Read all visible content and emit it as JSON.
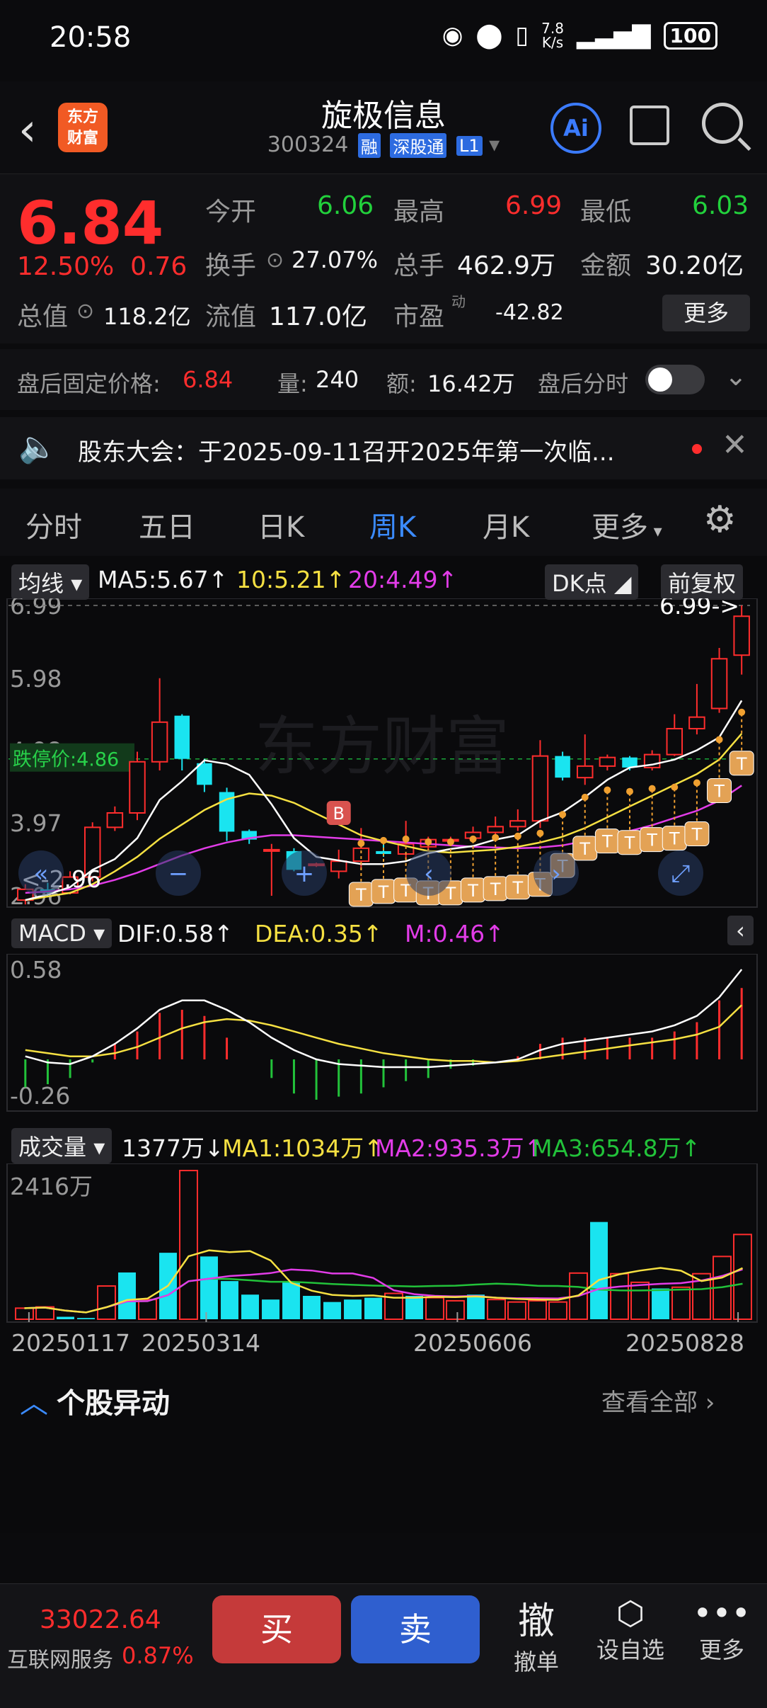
{
  "status": {
    "time": "20:58",
    "net_speed_top": "7.8",
    "net_speed_bottom": "K/s",
    "battery": "100"
  },
  "header": {
    "logo_line1": "东方",
    "logo_line2": "财富",
    "stock_name": "旋极信息",
    "stock_code": "300324",
    "tags": [
      "融",
      "深股通",
      "L1"
    ],
    "ai_label": "Ai"
  },
  "quote": {
    "price": "6.84",
    "change_pct": "12.50%",
    "change_amt": "0.76",
    "open_label": "今开",
    "open": "6.06",
    "high_label": "最高",
    "high": "6.99",
    "low_label": "最低",
    "low": "6.03",
    "turnover_label": "换手",
    "turnover": "27.07%",
    "volume_label": "总手",
    "volume": "462.9万",
    "amount_label": "金额",
    "amount": "30.20亿",
    "mktcap_label": "总值",
    "mktcap": "118.2亿",
    "float_label": "流值",
    "float": "117.0亿",
    "pe_label": "市盈",
    "pe_sup": "动",
    "pe": "-42.82",
    "more": "更多"
  },
  "afterhours": {
    "label": "盘后固定价格:",
    "price": "6.84",
    "vol_label": "量:",
    "vol": "240",
    "amt_label": "额:",
    "amt": "16.42万",
    "toggle_label": "盘后分时"
  },
  "notice": {
    "text": "股东大会：于2025-09-11召开2025年第一次临..."
  },
  "tabs": [
    "分时",
    "五日",
    "日K",
    "周K",
    "月K",
    "更多"
  ],
  "kline": {
    "ma_chip": "均线",
    "ma5": "MA5:5.67↑",
    "ma10": "10:5.21↑",
    "ma20": "20:4.49↑",
    "dk": "DK点",
    "fq": "前复权",
    "y_labels": [
      "6.99",
      "5.98",
      "4.98",
      "3.97",
      "2.96"
    ],
    "high_mark": "6.99->",
    "low_mark": "<-2.96",
    "limit_down": "跌停价:4.86",
    "watermark": "东方财富",
    "b_marker": "B",
    "t_marker": "T"
  },
  "macd": {
    "chip": "MACD",
    "dif": "DIF:0.58↑",
    "dea": "DEA:0.35↑",
    "m": "M:0.46↑",
    "y_top": "0.58",
    "y_bottom": "-0.26"
  },
  "vol": {
    "chip": "成交量",
    "cur": "1377万↓",
    "ma1": "MA1:1034万↑",
    "ma2": "MA2:935.3万↑",
    "ma3": "MA3:654.8万↑",
    "y_top": "2416万"
  },
  "dates": [
    "20250117",
    "20250314",
    "20250606",
    "20250828"
  ],
  "section": {
    "title": "个股异动",
    "link": "查看全部"
  },
  "bottom": {
    "index_value": "33022.64",
    "index_name": "互联网服务",
    "index_pct": "0.87%",
    "buy": "买",
    "sell": "卖",
    "cancel_icon": "撤",
    "cancel": "撤单",
    "watch": "设自选",
    "more": "更多"
  },
  "chart_data": {
    "type": "candlestick",
    "title": "",
    "ylim": [
      2.96,
      6.99
    ],
    "x_date_labels": [
      "20250117",
      "20250314",
      "20250606",
      "20250828"
    ],
    "candles": [
      [
        2.9,
        3.05,
        3.12,
        2.84
      ],
      [
        3.05,
        3.0,
        3.14,
        2.96
      ],
      [
        3.0,
        3.22,
        3.3,
        2.98
      ],
      [
        3.22,
        3.91,
        3.98,
        3.16
      ],
      [
        3.91,
        4.11,
        4.2,
        3.86
      ],
      [
        4.11,
        4.82,
        4.96,
        4.01
      ],
      [
        4.82,
        5.37,
        5.98,
        4.7
      ],
      [
        5.46,
        4.86,
        5.48,
        4.7
      ],
      [
        4.8,
        4.5,
        4.86,
        4.4
      ],
      [
        4.4,
        3.85,
        4.46,
        3.72
      ],
      [
        3.86,
        3.74,
        3.88,
        3.68
      ],
      [
        3.58,
        3.6,
        3.68,
        2.96
      ],
      [
        3.58,
        3.32,
        3.62,
        3.3
      ],
      [
        3.4,
        3.4,
        3.42,
        3.36
      ],
      [
        3.3,
        3.44,
        3.6,
        3.2
      ],
      [
        3.44,
        3.62,
        3.9,
        3.32
      ],
      [
        3.58,
        3.54,
        3.7,
        3.5
      ],
      [
        3.54,
        3.68,
        4.0,
        3.48
      ],
      [
        3.64,
        3.74,
        3.78,
        3.6
      ],
      [
        3.74,
        3.74,
        3.78,
        3.7
      ],
      [
        3.76,
        3.84,
        3.92,
        3.7
      ],
      [
        3.84,
        3.92,
        4.06,
        3.8
      ],
      [
        3.92,
        4.0,
        4.16,
        3.86
      ],
      [
        4.0,
        4.9,
        5.12,
        3.9
      ],
      [
        4.9,
        4.6,
        4.96,
        4.56
      ],
      [
        4.6,
        4.76,
        5.2,
        4.5
      ],
      [
        4.76,
        4.88,
        4.92,
        4.7
      ],
      [
        4.88,
        4.74,
        4.9,
        4.7
      ],
      [
        4.74,
        4.92,
        4.98,
        4.7
      ],
      [
        4.92,
        5.28,
        5.48,
        4.9
      ],
      [
        5.28,
        5.44,
        5.9,
        5.2
      ],
      [
        5.56,
        6.25,
        6.4,
        5.5
      ],
      [
        6.3,
        6.84,
        6.99,
        6.03
      ]
    ],
    "ma5": [
      2.9,
      2.98,
      3.08,
      3.32,
      3.47,
      3.76,
      4.29,
      4.55,
      4.84,
      4.79,
      4.64,
      4.23,
      3.76,
      3.5,
      3.45,
      3.4,
      3.4,
      3.44,
      3.55,
      3.61,
      3.65,
      3.74,
      3.8,
      4.0,
      4.12,
      4.33,
      4.57,
      4.74,
      4.78,
      4.85,
      4.98,
      5.16,
      5.67
    ],
    "ma10": [
      2.9,
      2.95,
      3.0,
      3.12,
      3.3,
      3.5,
      3.75,
      3.95,
      4.15,
      4.3,
      4.38,
      4.35,
      4.25,
      4.1,
      3.95,
      3.8,
      3.72,
      3.65,
      3.58,
      3.56,
      3.58,
      3.6,
      3.64,
      3.7,
      3.78,
      3.9,
      4.05,
      4.2,
      4.35,
      4.5,
      4.65,
      4.85,
      5.21
    ],
    "ma20": [
      3.0,
      3.02,
      3.05,
      3.1,
      3.18,
      3.28,
      3.4,
      3.52,
      3.62,
      3.7,
      3.76,
      3.8,
      3.8,
      3.78,
      3.76,
      3.74,
      3.72,
      3.7,
      3.68,
      3.66,
      3.64,
      3.63,
      3.62,
      3.63,
      3.66,
      3.72,
      3.78,
      3.86,
      3.94,
      4.04,
      4.14,
      4.28,
      4.49
    ],
    "macd": {
      "ylim": [
        -0.26,
        0.58
      ],
      "dif": [
        0.02,
        -0.02,
        -0.03,
        0.02,
        0.1,
        0.2,
        0.32,
        0.38,
        0.38,
        0.32,
        0.24,
        0.14,
        0.06,
        0.0,
        -0.03,
        -0.04,
        -0.05,
        -0.05,
        -0.05,
        -0.04,
        -0.03,
        -0.02,
        0.0,
        0.06,
        0.1,
        0.12,
        0.14,
        0.16,
        0.18,
        0.22,
        0.28,
        0.4,
        0.58
      ],
      "dea": [
        0.06,
        0.04,
        0.02,
        0.02,
        0.04,
        0.08,
        0.14,
        0.2,
        0.24,
        0.26,
        0.25,
        0.22,
        0.18,
        0.14,
        0.1,
        0.07,
        0.04,
        0.02,
        0.0,
        -0.01,
        -0.01,
        -0.02,
        -0.01,
        0.01,
        0.03,
        0.05,
        0.07,
        0.09,
        0.11,
        0.13,
        0.16,
        0.21,
        0.35
      ],
      "hist": [
        -0.18,
        -0.16,
        -0.12,
        -0.02,
        0.1,
        0.18,
        0.3,
        0.32,
        0.28,
        0.14,
        0.0,
        -0.12,
        -0.22,
        -0.26,
        -0.24,
        -0.22,
        -0.18,
        -0.14,
        -0.12,
        -0.06,
        -0.04,
        0.0,
        0.02,
        0.1,
        0.14,
        0.14,
        0.14,
        0.14,
        0.14,
        0.18,
        0.24,
        0.38,
        0.46
      ]
    },
    "volume": {
      "unit": "万",
      "ylim": [
        0,
        2416
      ],
      "values": [
        180,
        200,
        40,
        20,
        540,
        760,
        320,
        1080,
        2416,
        1020,
        620,
        400,
        320,
        600,
        380,
        280,
        320,
        350,
        420,
        380,
        350,
        300,
        400,
        320,
        280,
        300,
        280,
        750,
        1580,
        740,
        600,
        500,
        520,
        740,
        1020,
        1377
      ],
      "up": [
        true,
        true,
        false,
        false,
        true,
        false,
        true,
        false,
        true,
        false,
        false,
        false,
        false,
        false,
        false,
        false,
        false,
        false,
        true,
        false,
        true,
        true,
        false,
        true,
        true,
        true,
        true,
        true,
        false,
        true,
        true,
        false,
        true,
        true,
        true,
        true
      ]
    }
  }
}
